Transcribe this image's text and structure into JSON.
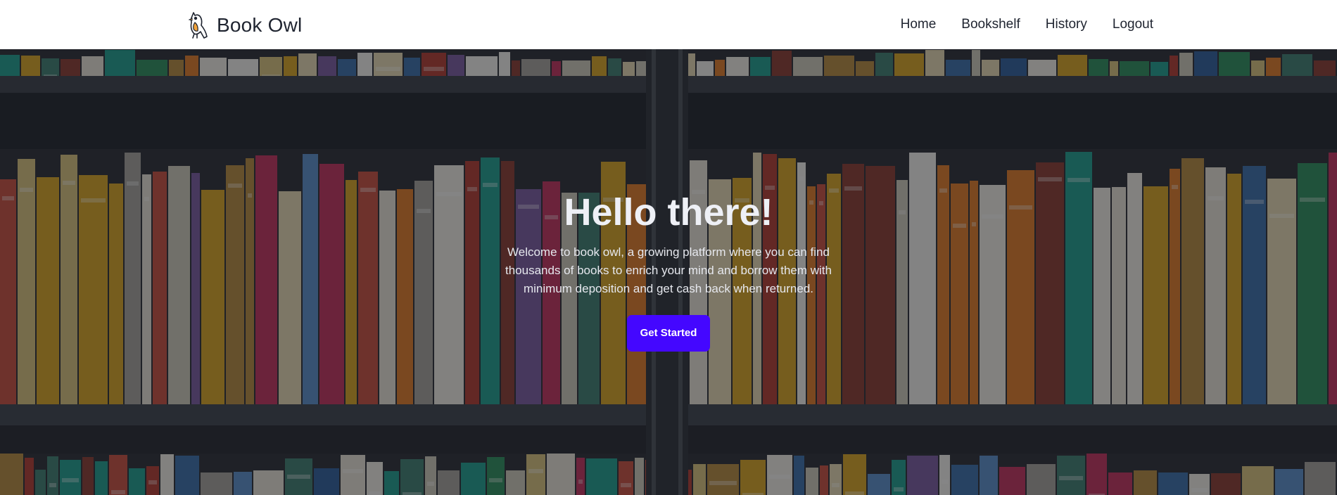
{
  "brand": {
    "name": "Book Owl",
    "logo_icon": "owl-icon"
  },
  "nav": {
    "items": [
      {
        "label": "Home"
      },
      {
        "label": "Bookshelf"
      },
      {
        "label": "History"
      },
      {
        "label": "Logout"
      }
    ]
  },
  "hero": {
    "title": "Hello there!",
    "text": "Welcome to book owl, a growing platform where you can find thousands of books to enrich your mind and borrow them with minimum deposition and get cash back when returned.",
    "cta_label": "Get Started",
    "background": "bookshelf-photo",
    "accent": "#4407ff"
  }
}
